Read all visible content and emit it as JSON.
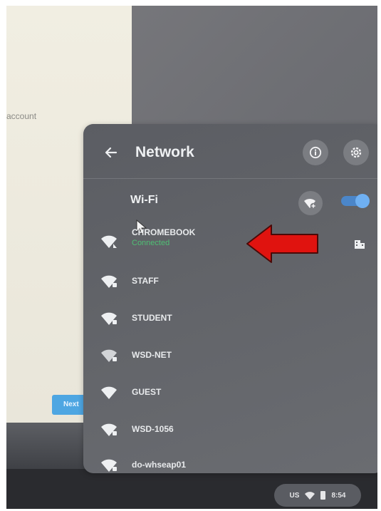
{
  "background": {
    "account_text": "account",
    "next_button": "Next"
  },
  "panel": {
    "title": "Network",
    "wifi_label": "Wi-Fi",
    "wifi_enabled": true
  },
  "networks": [
    {
      "name": "CHROMEBOOK",
      "status": "Connected"
    },
    {
      "name": "STAFF",
      "status": ""
    },
    {
      "name": "STUDENT",
      "status": ""
    },
    {
      "name": "WSD-NET",
      "status": ""
    },
    {
      "name": "GUEST",
      "status": ""
    },
    {
      "name": "WSD-1056",
      "status": ""
    },
    {
      "name": "do-whseap01",
      "status": ""
    }
  ],
  "status_tray": {
    "locale": "US",
    "time": "8:54"
  },
  "icons": {
    "back": "back-arrow-icon",
    "info": "info-icon",
    "settings": "gear-icon",
    "add_network": "add-wifi-icon",
    "wifi": "wifi-icon",
    "enterprise": "enterprise-building-icon"
  },
  "colors": {
    "panel_bg": "#626469",
    "toggle_on": "#4b86c9",
    "connected": "#4fbf74",
    "arrow": "#e0130f"
  }
}
